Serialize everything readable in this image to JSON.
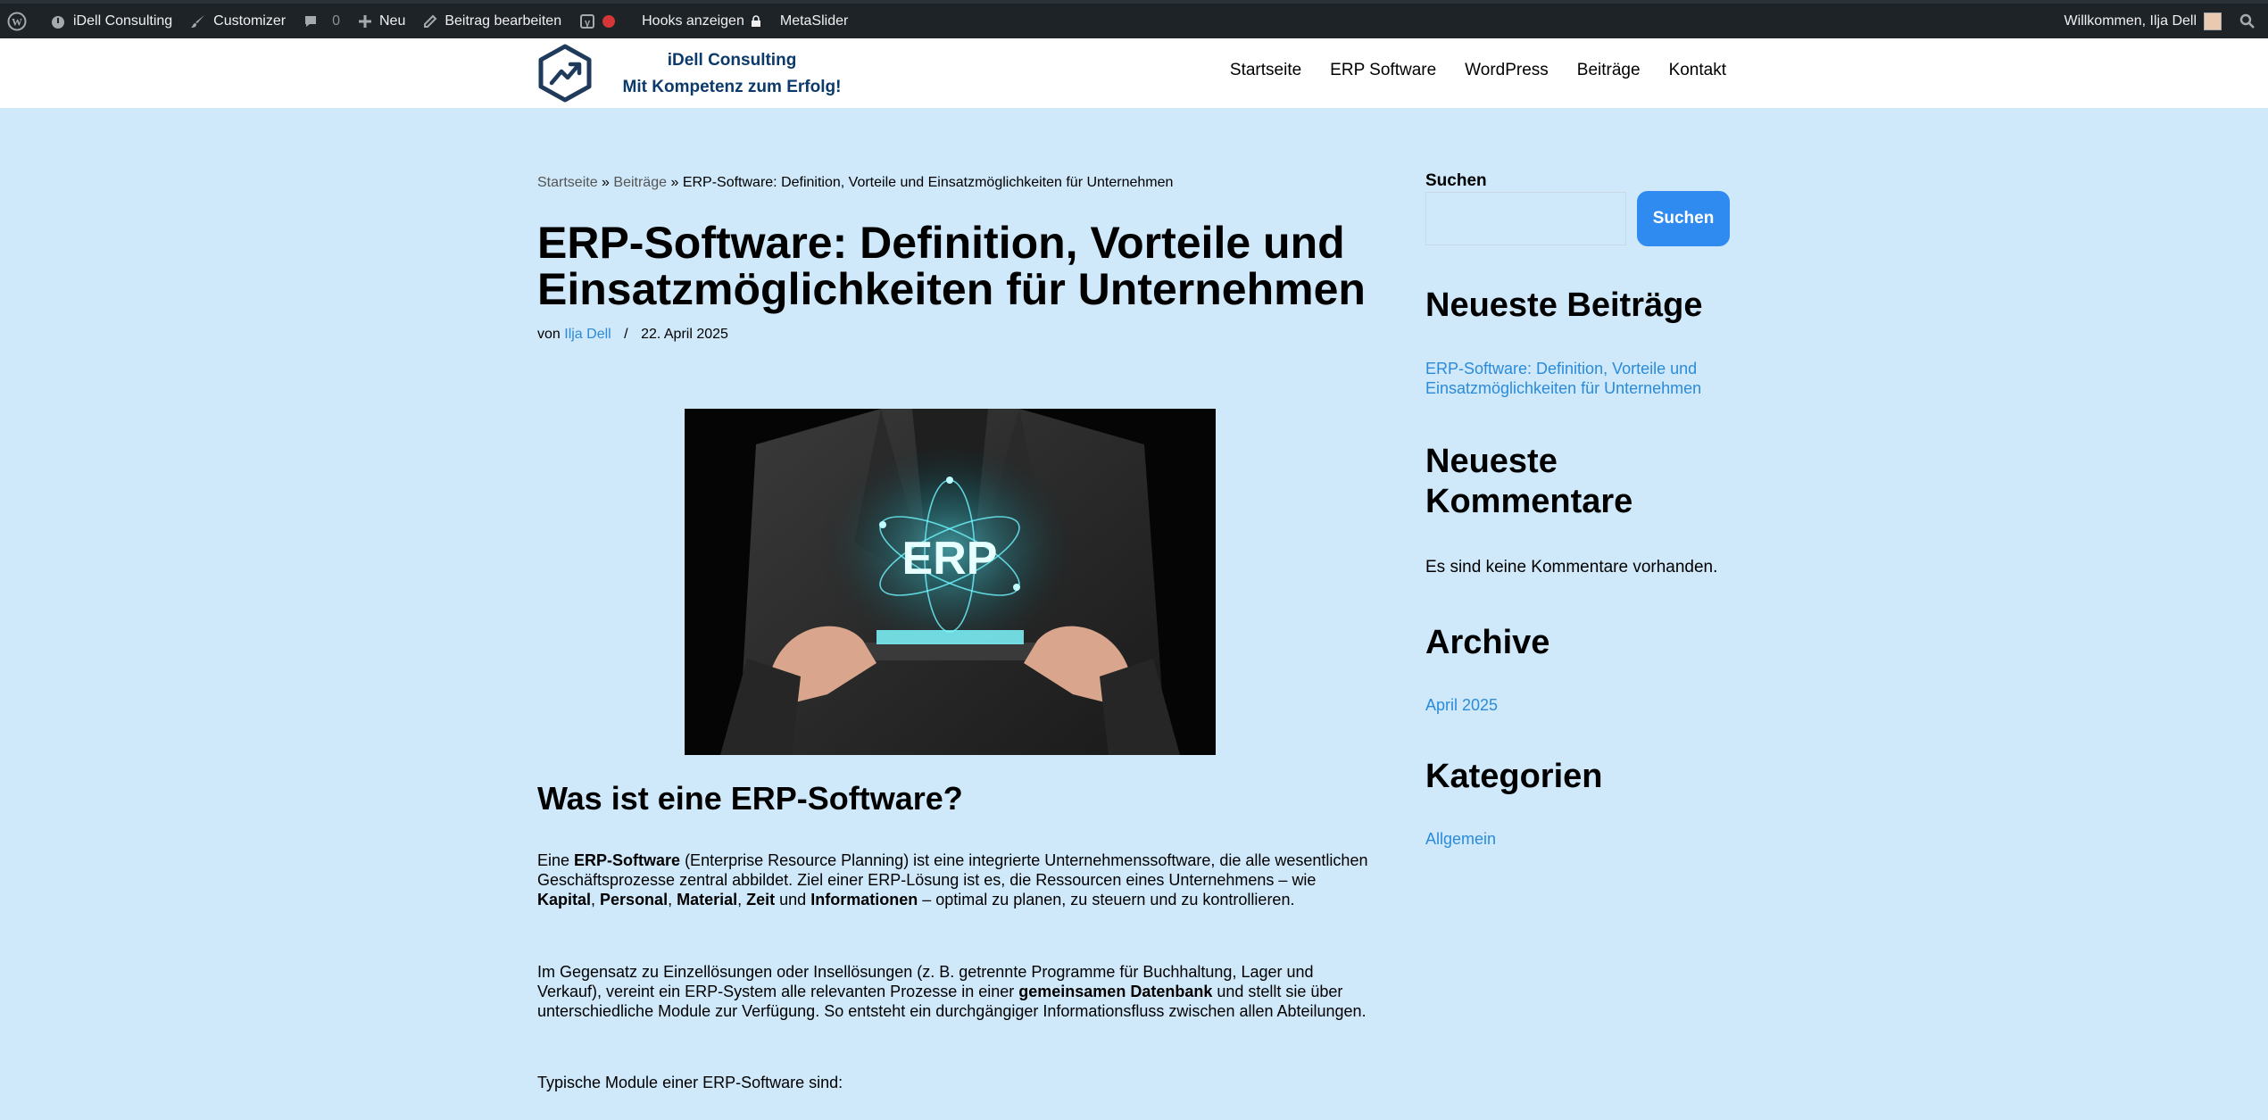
{
  "adminbar": {
    "site": "iDell Consulting",
    "customizer": "Customizer",
    "comments_count": "0",
    "new": "Neu",
    "edit_post": "Beitrag bearbeiten",
    "hooks": "Hooks anzeigen",
    "metaslider": "MetaSlider",
    "welcome": "Willkommen, Ilja Dell"
  },
  "header": {
    "brand_line1": "iDell Consulting",
    "brand_line2": "Mit Kompetenz zum Erfolg!",
    "nav": [
      "Startseite",
      "ERP Software",
      "WordPress",
      "Beiträge",
      "Kontakt"
    ]
  },
  "breadcrumb": {
    "home": "Startseite",
    "sep": "»",
    "posts": "Beiträge",
    "current": "ERP-Software: Definition, Vorteile und Einsatzmöglichkeiten für Unternehmen"
  },
  "post": {
    "title": "ERP-Software: Definition, Vorteile und Einsatzmöglichkeiten für Unternehmen",
    "by": "von",
    "author": "Ilja Dell",
    "date": "22. April 2025",
    "image_text": "ERP",
    "section_heading": "Was ist eine ERP-Software?",
    "p1": {
      "t1": "Eine ",
      "b1": "ERP-Software",
      "t2": " (Enterprise Resource Planning) ist eine integrierte Unternehmenssoftware, die alle wesentlichen Geschäftsprozesse zentral abbildet. Ziel einer ERP-Lösung ist es, die Ressourcen eines Unternehmens – wie ",
      "b2": "Kapital",
      "t3": ", ",
      "b3": "Personal",
      "t4": ", ",
      "b4": "Material",
      "t5": ", ",
      "b5": "Zeit",
      "t6": " und ",
      "b6": "Informationen",
      "t7": " – optimal zu planen, zu steuern und zu kontrollieren."
    },
    "p2": {
      "t1": "Im Gegensatz zu Einzellösungen oder Insellösungen (z. B. getrennte Programme für Buchhaltung, Lager und Verkauf), vereint ein ERP-System alle relevanten Prozesse in einer ",
      "b1": "gemeinsamen Datenbank",
      "t2": " und stellt sie über unterschiedliche Module zur Verfügung. So entsteht ein durchgängiger Informationsfluss zwischen allen Abteilungen."
    },
    "p3": "Typische Module einer ERP-Software sind:"
  },
  "sidebar": {
    "search_label": "Suchen",
    "search_button": "Suchen",
    "recent_posts_heading": "Neueste Beiträge",
    "recent_post": "ERP-Software: Definition, Vorteile und Einsatzmöglichkeiten für Unternehmen",
    "recent_comments_heading": "Neueste Kommentare",
    "no_comments": "Es sind keine Kommentare vorhanden.",
    "archive_heading": "Archive",
    "archive_item": "April 2025",
    "categories_heading": "Kategorien",
    "category_item": "Allgemein"
  },
  "colors": {
    "adminbar_bg": "#1d2327",
    "page_bg": "#cfe8fa",
    "link": "#2b8bd8",
    "button": "#2f8bf0",
    "brand": "#0b3a6b"
  }
}
